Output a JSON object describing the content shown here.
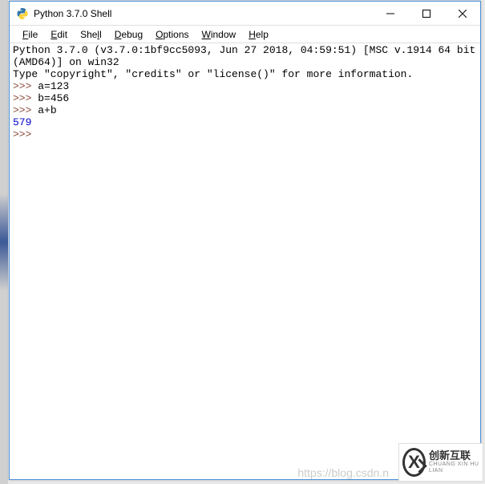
{
  "window": {
    "title": "Python 3.7.0 Shell"
  },
  "menu": {
    "file": "File",
    "edit": "Edit",
    "shell": "Shell",
    "debug": "Debug",
    "options": "Options",
    "window": "Window",
    "help": "Help"
  },
  "shell": {
    "banner_line1": "Python 3.7.0 (v3.7.0:1bf9cc5093, Jun 27 2018, 04:59:51) [MSC v.1914 64 bit (AMD64)] on win32",
    "banner_line2": "Type \"copyright\", \"credits\" or \"license()\" for more information.",
    "prompt": ">>>",
    "lines": [
      {
        "type": "input",
        "text": "a=123"
      },
      {
        "type": "input",
        "text": "b=456"
      },
      {
        "type": "input",
        "text": "a+b"
      },
      {
        "type": "output",
        "text": "579"
      },
      {
        "type": "prompt_only",
        "text": ""
      }
    ]
  },
  "watermark": {
    "url": "https://blog.csdn.n",
    "logo_main": "创新互联",
    "logo_sub": "CHUANG XIN HU LIAN"
  }
}
